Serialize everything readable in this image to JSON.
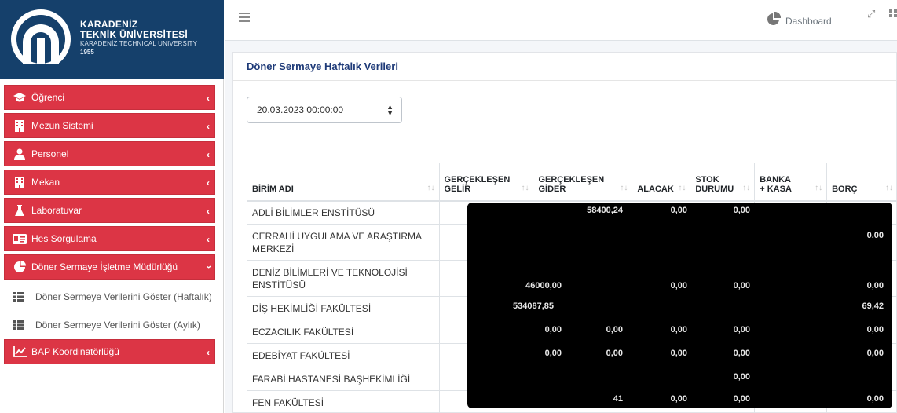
{
  "brand": {
    "line1": "KARADENİZ",
    "line2": "TEKNİK ÜNİVERSİTESİ",
    "line3": "KARADENİZ TECHNICAL UNIVERSITY",
    "year": "1955",
    "color": "#15406b"
  },
  "sidebar": {
    "accent": "#dc3545",
    "items": [
      {
        "label": "Öğrenci",
        "icon": "graduation-cap-icon"
      },
      {
        "label": "Mezun Sistemi",
        "icon": "building-icon"
      },
      {
        "label": "Personel",
        "icon": "users-icon"
      },
      {
        "label": "Mekan",
        "icon": "building-icon"
      },
      {
        "label": "Laboratuvar",
        "icon": "flask-icon"
      },
      {
        "label": "Hes Sorgulama",
        "icon": "id-card-icon"
      },
      {
        "label": "Döner Sermaye İşletme Müdürlüğü",
        "icon": "pie-chart-icon"
      },
      {
        "label": "BAP Koordinatörlüğü",
        "icon": "line-chart-icon"
      }
    ],
    "subitems": [
      {
        "label": "Döner Sermeye Verilerini Göster (Haftalık)",
        "icon": "list-icon"
      },
      {
        "label": "Döner Sermeye Verilerini Göster (Aylık)",
        "icon": "list-icon"
      }
    ]
  },
  "topbar": {
    "dashboard_label": "Dashboard"
  },
  "card": {
    "title": "Döner Sermaye Haftalık Verileri",
    "date_select_value": "20.03.2023 00:00:00"
  },
  "table": {
    "headers": {
      "birim": "BİRİM ADI",
      "gelir_1": "GERÇEKLEŞEN",
      "gelir_2": "GELİR",
      "gider_1": "GERÇEKLEŞEN",
      "gider_2": "GİDER",
      "alacak": "ALACAK",
      "stok_1": "STOK",
      "stok_2": "DURUMU",
      "banka_1": "BANKA",
      "banka_2": "+ KASA",
      "borc": "BORÇ"
    },
    "rows": [
      {
        "name": "ADLİ BİLİMLER ENSTİTÜSÜ"
      },
      {
        "name": "CERRAHİ UYGULAMA VE ARAŞTIRMA MERKEZİ"
      },
      {
        "name": "DENİZ BİLİMLERİ VE TEKNOLOJİSİ ENSTİTÜSÜ"
      },
      {
        "name": "DİŞ HEKİMLİĞİ FAKÜLTESİ"
      },
      {
        "name": "ECZACILIK FAKÜLTESİ"
      },
      {
        "name": "EDEBİYAT FAKÜLTESİ"
      },
      {
        "name": "FARABİ HASTANESİ BAŞHEKİMLİĞİ"
      },
      {
        "name": "FEN FAKÜLTESİ"
      }
    ],
    "visible_values": {
      "r0_gider": "58400,24",
      "r0_alacak": "0,00",
      "r0_stok": "0,00",
      "r1_borc": "0,00",
      "r2_gelir": "46000,00",
      "r2_alacak": "0,00",
      "r2_stok": "0,00",
      "r2_borc": "0,00",
      "r3_gelir": "534087,85",
      "r3_borc": "69,42",
      "r4_gelir": "0,00",
      "r4_gider": "0,00",
      "r4_alacak": "0,00",
      "r4_stok": "0,00",
      "r4_borc": "0,00",
      "r5_gelir": "0,00",
      "r5_gider": "0,00",
      "r5_alacak": "0,00",
      "r5_stok": "0,00",
      "r5_borc": "0,00",
      "r6_stok": "0,00",
      "r7_gider": "41",
      "r7_alacak": "0,00",
      "r7_stok": "0,00",
      "r7_borc": "0,00"
    }
  }
}
